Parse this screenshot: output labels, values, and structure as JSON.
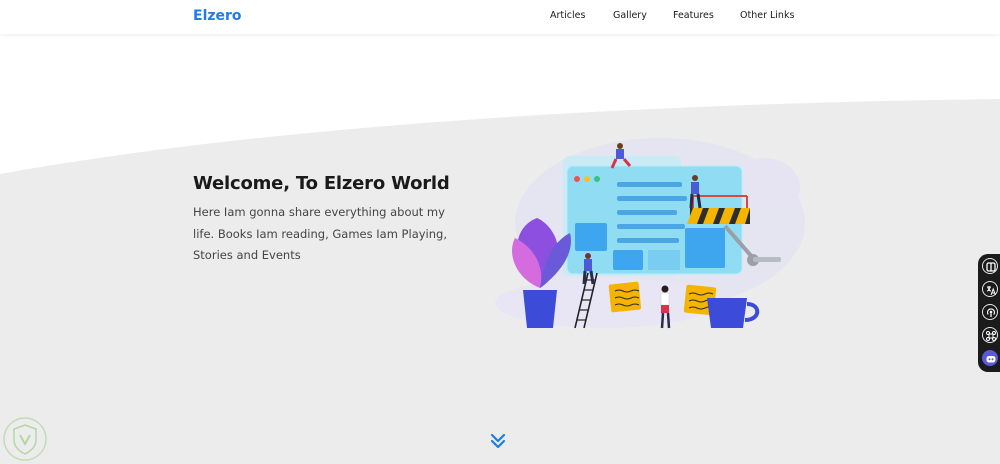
{
  "brand": {
    "name": "Elzero",
    "color": "#1f7ce8"
  },
  "nav": {
    "items": [
      {
        "label": "Articles"
      },
      {
        "label": "Gallery"
      },
      {
        "label": "Features"
      },
      {
        "label": "Other Links"
      }
    ]
  },
  "hero": {
    "title": "Welcome, To Elzero World",
    "description": "Here Iam gonna share everything about my life. Books Iam reading, Games Iam Playing, Stories and Events",
    "background_color": "#ececec",
    "illustration_icon": "web-development-illustration"
  },
  "scroll_down": {
    "icon": "double-chevron-down-icon",
    "color": "#1f7ce8"
  },
  "side_toolbar": {
    "icons": [
      "split-view-icon",
      "translate-icon",
      "podcast-icon",
      "command-icon",
      "assistant-icon"
    ]
  },
  "watermark": {
    "icon": "shield-watermark-icon"
  }
}
